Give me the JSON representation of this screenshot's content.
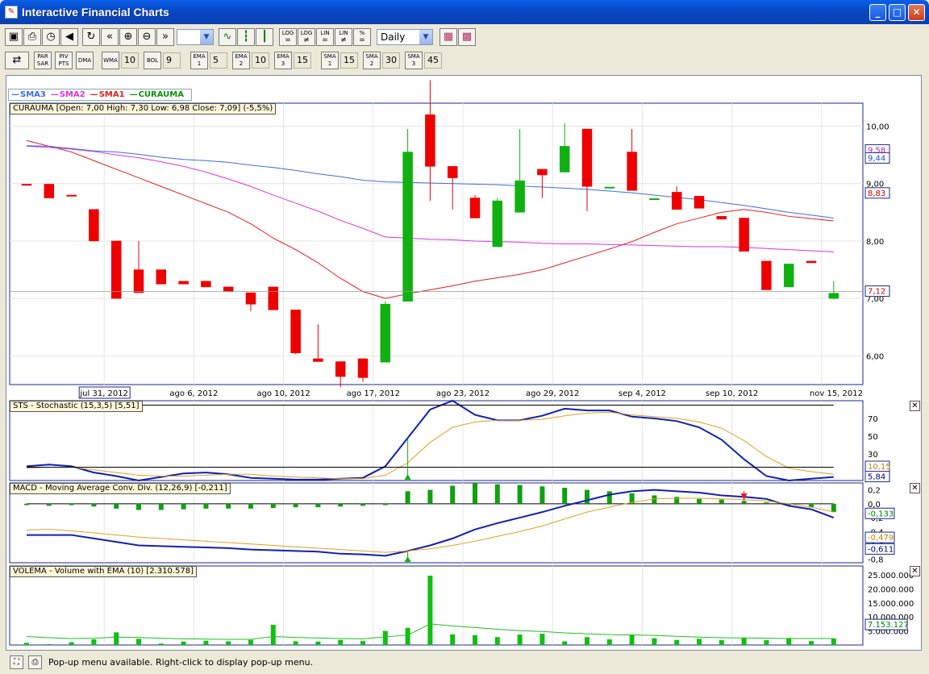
{
  "window": {
    "title": "Interactive Financial Charts"
  },
  "toolbar1": {
    "buttons": [
      {
        "name": "window-icon",
        "glyph": "▣"
      },
      {
        "name": "print-icon",
        "glyph": "⎙"
      },
      {
        "name": "timer-icon",
        "glyph": "◷"
      },
      {
        "name": "sound-icon",
        "glyph": "◀"
      },
      {
        "name": "refresh-icon",
        "glyph": "↻"
      },
      {
        "name": "rewind-icon",
        "glyph": "«"
      },
      {
        "name": "zoom-in-icon",
        "glyph": "⊕"
      },
      {
        "name": "zoom-out-icon",
        "glyph": "⊖"
      },
      {
        "name": "fast-forward-icon",
        "glyph": "»"
      }
    ],
    "chart_type_buttons": [
      {
        "name": "line-chart-icon",
        "glyph": "∿"
      },
      {
        "name": "bar-chart-icon",
        "glyph": "┇"
      },
      {
        "name": "candlestick-icon",
        "glyph": "┃"
      }
    ],
    "scale_buttons": [
      {
        "top": "LOG",
        "bottom": "="
      },
      {
        "top": "LOG",
        "bottom": "≠"
      },
      {
        "top": "LIN",
        "bottom": "="
      },
      {
        "top": "LIN",
        "bottom": "≠"
      },
      {
        "top": "%",
        "bottom": "="
      }
    ],
    "period_select": "Daily",
    "extra_buttons": [
      {
        "name": "chart-settings-icon",
        "glyph": "▦"
      },
      {
        "name": "color-palette-icon",
        "glyph": "▩"
      }
    ]
  },
  "toolbar2": {
    "indicators": [
      {
        "label": "PAR SAR",
        "value": ""
      },
      {
        "label": "PIV PTS",
        "value": ""
      },
      {
        "label": "DMA",
        "value": ""
      },
      {
        "label": "WMA",
        "value": "10"
      },
      {
        "label": "BOL",
        "value": "9"
      },
      {
        "label": "EMA 1",
        "value": "5"
      },
      {
        "label": "EMA 2",
        "value": "10"
      },
      {
        "label": "EMA 3",
        "value": "15"
      },
      {
        "label": "SMA 1",
        "value": "15"
      },
      {
        "label": "SMA 2",
        "value": "30"
      },
      {
        "label": "SMA 3",
        "value": "45"
      }
    ]
  },
  "legend": {
    "items": [
      {
        "name": "SMA3",
        "color": "#3a6fe0"
      },
      {
        "name": "SMA2",
        "color": "#e033e0"
      },
      {
        "name": "SMA1",
        "color": "#e02020"
      },
      {
        "name": "CURAUMA",
        "color": "#109010"
      }
    ]
  },
  "price_panel": {
    "label": "CURAUMA [Open: 7,00  High: 7,30  Low: 6,98  Close: 7,09] (-5,5%)",
    "y_ticks": [
      "10,00",
      "9,00",
      "8,00",
      "7,00",
      "6,00"
    ],
    "badges": [
      {
        "text": "9,58",
        "color": "#c020c0",
        "value": 9.58
      },
      {
        "text": "9,44",
        "color": "#2050c0",
        "value": 9.44
      },
      {
        "text": "8,83",
        "color": "#d00000",
        "value": 8.83
      },
      {
        "text": "7,12",
        "color": "#d00000",
        "value": 7.12
      }
    ]
  },
  "x_axis": {
    "labels": [
      "jul 31, 2012",
      "ago 6, 2012",
      "ago 10, 2012",
      "ago 17, 2012",
      "ago 23, 2012",
      "ago 29, 2012",
      "sep 4, 2012",
      "sep 10, 2012",
      "nov 15, 2012"
    ],
    "label_index": [
      4,
      8,
      12,
      16,
      20,
      24,
      28,
      32,
      36
    ]
  },
  "sts_panel": {
    "label": "STS - Stochastic (15,3,5) [5,51]",
    "y_ticks": [
      "70",
      "50",
      "30"
    ],
    "badges": [
      {
        "text": "10,15",
        "color": "#c08000"
      },
      {
        "text": "5,84",
        "color": "#000080"
      }
    ]
  },
  "macd_panel": {
    "label": "MACD - Moving Average Conv. Div. (12,26,9) [-0,211]",
    "y_ticks": [
      "0,2",
      "0,0",
      "-0,2",
      "-0,4",
      "-0,6",
      "-0,8"
    ],
    "badges": [
      {
        "text": "-0,133",
        "color": "#008000"
      },
      {
        "text": "-0,479",
        "color": "#c08000"
      },
      {
        "text": "-0,611",
        "color": "#000080"
      }
    ]
  },
  "vol_panel": {
    "label": "VOLEMA - Volume with EMA (10) [2.310.578]",
    "y_ticks": [
      "25.000.000",
      "20.000.000",
      "15.000.000",
      "10.000.000",
      "5.000.000"
    ],
    "badges": [
      {
        "text": "7.153.127",
        "color": "#008000"
      }
    ]
  },
  "status": {
    "text": "Pop-up menu available. Right-click to display pop-up menu."
  },
  "chart_data": [
    {
      "type": "candlestick",
      "title": "CURAUMA",
      "x_labels_shown": [
        "jul 31, 2012",
        "ago 6, 2012",
        "ago 10, 2012",
        "ago 17, 2012",
        "ago 23, 2012",
        "ago 29, 2012",
        "sep 4, 2012",
        "sep 10, 2012",
        "nov 15, 2012"
      ],
      "ylim": [
        5.5,
        10.4
      ],
      "candles": [
        {
          "o": 8.99,
          "h": 8.99,
          "l": 8.98,
          "c": 8.98
        },
        {
          "o": 8.99,
          "h": 8.99,
          "l": 8.75,
          "c": 8.75
        },
        {
          "o": 8.8,
          "h": 8.8,
          "l": 8.78,
          "c": 8.78
        },
        {
          "o": 8.55,
          "h": 8.55,
          "l": 8.0,
          "c": 8.0
        },
        {
          "o": 8.0,
          "h": 8.0,
          "l": 7.0,
          "c": 7.0
        },
        {
          "o": 7.5,
          "h": 8.0,
          "l": 7.1,
          "c": 7.1
        },
        {
          "o": 7.5,
          "h": 7.5,
          "l": 7.25,
          "c": 7.25
        },
        {
          "o": 7.3,
          "h": 7.3,
          "l": 7.25,
          "c": 7.25
        },
        {
          "o": 7.3,
          "h": 7.3,
          "l": 7.2,
          "c": 7.2
        },
        {
          "o": 7.2,
          "h": 7.2,
          "l": 7.12,
          "c": 7.12
        },
        {
          "o": 7.1,
          "h": 7.1,
          "l": 6.78,
          "c": 6.9
        },
        {
          "o": 7.2,
          "h": 7.2,
          "l": 6.8,
          "c": 6.8
        },
        {
          "o": 6.8,
          "h": 6.8,
          "l": 6.03,
          "c": 6.05
        },
        {
          "o": 5.95,
          "h": 6.55,
          "l": 5.95,
          "c": 5.9
        },
        {
          "o": 5.9,
          "h": 5.9,
          "l": 5.45,
          "c": 5.64
        },
        {
          "o": 5.95,
          "h": 5.95,
          "l": 5.55,
          "c": 5.62
        },
        {
          "o": 5.89,
          "h": 6.95,
          "l": 5.89,
          "c": 6.9
        },
        {
          "o": 6.95,
          "h": 9.95,
          "l": 6.95,
          "c": 9.55
        },
        {
          "o": 10.2,
          "h": 10.8,
          "l": 8.7,
          "c": 9.3
        },
        {
          "o": 9.3,
          "h": 9.3,
          "l": 8.55,
          "c": 9.1
        },
        {
          "o": 8.75,
          "h": 8.8,
          "l": 8.4,
          "c": 8.4
        },
        {
          "o": 7.9,
          "h": 8.75,
          "l": 7.9,
          "c": 8.7
        },
        {
          "o": 8.5,
          "h": 9.95,
          "l": 8.5,
          "c": 9.05
        },
        {
          "o": 9.25,
          "h": 9.25,
          "l": 8.75,
          "c": 9.15
        },
        {
          "o": 9.2,
          "h": 10.05,
          "l": 9.2,
          "c": 9.65
        },
        {
          "o": 9.95,
          "h": 9.95,
          "l": 8.52,
          "c": 8.95
        },
        {
          "o": 8.94,
          "h": 8.94,
          "l": 8.94,
          "c": 8.94
        },
        {
          "o": 9.55,
          "h": 9.95,
          "l": 8.88,
          "c": 8.88
        },
        {
          "o": 8.74,
          "h": 8.74,
          "l": 8.74,
          "c": 8.74
        },
        {
          "o": 8.85,
          "h": 8.95,
          "l": 8.55,
          "c": 8.55
        },
        {
          "o": 8.78,
          "h": 8.78,
          "l": 8.57,
          "c": 8.57
        },
        {
          "o": 8.43,
          "h": 8.43,
          "l": 8.38,
          "c": 8.38
        },
        {
          "o": 8.4,
          "h": 8.4,
          "l": 7.82,
          "c": 7.82
        },
        {
          "o": 7.65,
          "h": 7.65,
          "l": 7.15,
          "c": 7.15
        },
        {
          "o": 7.2,
          "h": 7.6,
          "l": 7.2,
          "c": 7.6
        },
        {
          "o": 7.65,
          "h": 7.65,
          "l": 7.62,
          "c": 7.62
        },
        {
          "o": 7.0,
          "h": 7.3,
          "l": 6.98,
          "c": 7.09
        }
      ],
      "series": [
        {
          "name": "SMA1",
          "values": [
            9.75,
            9.65,
            9.55,
            9.4,
            9.25,
            9.1,
            8.95,
            8.8,
            8.65,
            8.5,
            8.3,
            8.05,
            7.85,
            7.62,
            7.35,
            7.12,
            7.0,
            7.08,
            7.15,
            7.22,
            7.3,
            7.36,
            7.42,
            7.5,
            7.62,
            7.74,
            7.86,
            7.99,
            8.15,
            8.3,
            8.4,
            8.5,
            8.55,
            8.5,
            8.43,
            8.39,
            8.35
          ]
        },
        {
          "name": "SMA2",
          "values": [
            9.65,
            9.63,
            9.6,
            9.56,
            9.5,
            9.45,
            9.38,
            9.3,
            9.2,
            9.08,
            8.95,
            8.8,
            8.66,
            8.52,
            8.36,
            8.22,
            8.07,
            8.05,
            8.03,
            8.02,
            8.0,
            7.99,
            7.98,
            7.96,
            7.95,
            7.95,
            7.94,
            7.93,
            7.92,
            7.91,
            7.9,
            7.9,
            7.89,
            7.87,
            7.85,
            7.83,
            7.81
          ]
        },
        {
          "name": "SMA3",
          "values": [
            9.66,
            9.65,
            9.61,
            9.57,
            9.55,
            9.51,
            9.46,
            9.42,
            9.4,
            9.37,
            9.32,
            9.28,
            9.23,
            9.17,
            9.12,
            9.06,
            9.03,
            9.02,
            9.01,
            9.0,
            8.99,
            8.98,
            8.96,
            8.94,
            8.92,
            8.9,
            8.87,
            8.84,
            8.8,
            8.76,
            8.72,
            8.67,
            8.62,
            8.56,
            8.5,
            8.45,
            8.4
          ]
        }
      ]
    },
    {
      "type": "line",
      "title": "STS - Stochastic (15,3,5)",
      "ylim": [
        0,
        90
      ],
      "series": [
        {
          "name": "%K",
          "values": [
            16,
            18,
            16,
            9,
            5,
            0,
            4,
            8,
            9,
            7,
            3,
            2,
            1,
            1,
            2,
            3,
            16,
            48,
            80,
            90,
            74,
            68,
            68,
            73,
            81,
            79,
            79,
            72,
            70,
            67,
            60,
            46,
            24,
            5,
            0,
            2,
            4
          ]
        },
        {
          "name": "%D",
          "values": [
            14,
            15,
            15,
            12,
            9,
            6,
            5,
            5,
            6,
            7,
            7,
            5,
            4,
            3,
            2,
            2,
            6,
            20,
            43,
            60,
            66,
            68,
            68,
            69,
            73,
            76,
            77,
            74,
            72,
            70,
            66,
            59,
            45,
            27,
            14,
            10,
            7
          ]
        },
        {
          "name": "level",
          "values": [
            85,
            85,
            85,
            85,
            85,
            85,
            85,
            85,
            85,
            85,
            85,
            85,
            85,
            85,
            85,
            85,
            85,
            85,
            85,
            85,
            85,
            85,
            85,
            85,
            85,
            85,
            85,
            85,
            85,
            85,
            85,
            85,
            85,
            85,
            85,
            85,
            85
          ]
        },
        {
          "name": "level",
          "values": [
            15,
            15,
            15,
            15,
            15,
            15,
            15,
            15,
            15,
            15,
            15,
            15,
            15,
            15,
            15,
            15,
            15,
            15,
            15,
            15,
            15,
            15,
            15,
            15,
            15,
            15,
            15,
            15,
            15,
            15,
            15,
            15,
            15,
            15,
            15,
            15,
            15
          ]
        }
      ],
      "markers": [
        {
          "index": 17,
          "type": "buy"
        }
      ]
    },
    {
      "type": "bar+line",
      "title": "MACD - Moving Average Conv. Div. (12,26,9)",
      "ylim": [
        -0.85,
        0.3
      ],
      "series": [
        {
          "name": "MACD",
          "values": [
            -0.45,
            -0.45,
            -0.45,
            -0.5,
            -0.55,
            -0.6,
            -0.61,
            -0.62,
            -0.63,
            -0.64,
            -0.66,
            -0.67,
            -0.68,
            -0.69,
            -0.72,
            -0.73,
            -0.75,
            -0.68,
            -0.6,
            -0.5,
            -0.37,
            -0.28,
            -0.2,
            -0.12,
            -0.03,
            0.05,
            0.13,
            0.18,
            0.2,
            0.18,
            0.16,
            0.12,
            0.1,
            0.07,
            -0.03,
            -0.08,
            -0.2
          ]
        },
        {
          "name": "Signal",
          "values": [
            -0.38,
            -0.37,
            -0.39,
            -0.42,
            -0.45,
            -0.48,
            -0.5,
            -0.52,
            -0.54,
            -0.56,
            -0.58,
            -0.6,
            -0.62,
            -0.64,
            -0.66,
            -0.68,
            -0.7,
            -0.68,
            -0.65,
            -0.6,
            -0.54,
            -0.47,
            -0.4,
            -0.32,
            -0.22,
            -0.12,
            -0.05,
            0.02,
            0.07,
            0.08,
            0.08,
            0.07,
            0.06,
            0.04,
            0.0,
            -0.05,
            -0.12
          ]
        },
        {
          "name": "Histogram",
          "values": [
            -0.02,
            -0.03,
            -0.02,
            -0.04,
            -0.07,
            -0.09,
            -0.09,
            -0.08,
            -0.07,
            -0.07,
            -0.07,
            -0.06,
            -0.05,
            -0.05,
            -0.04,
            -0.03,
            -0.02,
            0.18,
            0.2,
            0.26,
            0.3,
            0.28,
            0.27,
            0.25,
            0.23,
            0.2,
            0.18,
            0.15,
            0.12,
            0.1,
            0.07,
            0.06,
            0.04,
            0.02,
            -0.02,
            -0.05,
            -0.12
          ]
        }
      ],
      "markers": [
        {
          "index": 17,
          "type": "buy"
        },
        {
          "index": 32,
          "type": "sell"
        }
      ]
    },
    {
      "type": "bar+line",
      "title": "VOLEMA - Volume with EMA (10)",
      "ylim": [
        0,
        27000000
      ],
      "series": [
        {
          "name": "Volume",
          "values": [
            800000,
            300000,
            1000000,
            2000000,
            4500000,
            2200000,
            500000,
            1200000,
            1500000,
            1300000,
            1800000,
            7200000,
            1300000,
            1200000,
            1800000,
            1400000,
            5000000,
            6100000,
            28000000,
            3800000,
            3500000,
            2800000,
            3700000,
            4000000,
            1300000,
            2800000,
            2000000,
            3700000,
            2400000,
            1800000,
            2200000,
            1700000,
            2500000,
            1700000,
            2500000,
            1400000,
            2310578
          ]
        },
        {
          "name": "EMA (10)",
          "values": [
            3000000,
            2600000,
            2300000,
            2400000,
            2800000,
            2700000,
            2400000,
            2200000,
            2100000,
            2000000,
            2000000,
            3000000,
            2700000,
            2500000,
            2300000,
            2200000,
            2900000,
            3500000,
            7500000,
            6800000,
            6200000,
            5600000,
            5100000,
            4800000,
            4300000,
            4000000,
            3700000,
            3600000,
            3400000,
            3100000,
            2800000,
            2600000,
            2500000,
            2400000,
            2300000,
            2300000,
            2310578
          ]
        }
      ]
    }
  ]
}
